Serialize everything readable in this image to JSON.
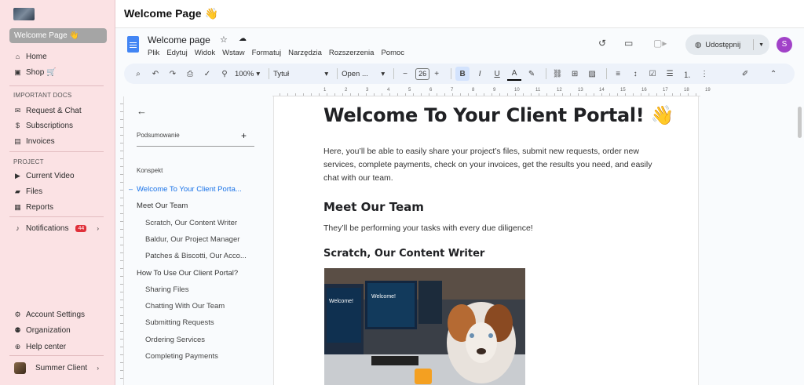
{
  "sidebar": {
    "active_item": "Welcome Page 👋",
    "items": [
      {
        "label": "Home",
        "icon": "home-icon",
        "glyph": "⌂"
      },
      {
        "label": "Shop 🛒",
        "icon": "cart-icon",
        "glyph": "🛒"
      }
    ],
    "important_docs_label": "IMPORTANT DOCS",
    "important_docs": [
      {
        "label": "Request & Chat",
        "icon": "chat-icon",
        "glyph": "✉"
      },
      {
        "label": "Subscriptions",
        "icon": "dollar-icon",
        "glyph": "$"
      },
      {
        "label": "Invoices",
        "icon": "file-icon",
        "glyph": "▤"
      }
    ],
    "project_label": "PROJECT",
    "project": [
      {
        "label": "Current Video",
        "icon": "video-icon",
        "glyph": "▶"
      },
      {
        "label": "Files",
        "icon": "folder-icon",
        "glyph": "▰"
      },
      {
        "label": "Reports",
        "icon": "report-icon",
        "glyph": "▦"
      }
    ],
    "notifications": {
      "label": "Notifications",
      "badge": "44"
    },
    "bottom": [
      {
        "label": "Account Settings",
        "icon": "gear-icon",
        "glyph": "⚙"
      },
      {
        "label": "Organization",
        "icon": "people-icon",
        "glyph": "⚉"
      },
      {
        "label": "Help center",
        "icon": "help-icon",
        "glyph": "⊕"
      }
    ],
    "user": "Summer Client"
  },
  "header": {
    "title": "Welcome Page 👋"
  },
  "docs": {
    "title": "Welcome page",
    "menu": [
      "Plik",
      "Edytuj",
      "Widok",
      "Wstaw",
      "Formatuj",
      "Narzędzia",
      "Rozszerzenia",
      "Pomoc"
    ],
    "share_label": "Udostępnij",
    "user_initial": "S",
    "user_color": "#a142c8",
    "toolbar": {
      "zoom": "100%",
      "style": "Tytuł",
      "font": "Open ...",
      "font_size": "26"
    },
    "ruler_numbers": [
      "1",
      "2",
      "3",
      "4",
      "5",
      "6",
      "7",
      "8",
      "9",
      "10",
      "11",
      "12",
      "13",
      "14",
      "15",
      "16",
      "17",
      "18",
      "19"
    ],
    "outline": {
      "summary_label": "Podsumowanie",
      "outline_label": "Konspekt",
      "items": [
        {
          "label": "Welcome To Your Client Porta...",
          "level": 1,
          "active": true
        },
        {
          "label": "Meet Our Team",
          "level": 1,
          "active": false
        },
        {
          "label": "Scratch, Our Content Writer",
          "level": 2,
          "active": false
        },
        {
          "label": "Baldur, Our Project Manager",
          "level": 2,
          "active": false
        },
        {
          "label": "Patches & Biscotti, Our Acco...",
          "level": 2,
          "active": false
        },
        {
          "label": "How To Use Our Client Portal?",
          "level": 1,
          "active": false
        },
        {
          "label": "Sharing Files",
          "level": 2,
          "active": false
        },
        {
          "label": "Chatting With Our Team",
          "level": 2,
          "active": false
        },
        {
          "label": "Submitting Requests",
          "level": 2,
          "active": false
        },
        {
          "label": "Ordering Services",
          "level": 2,
          "active": false
        },
        {
          "label": "Completing Payments",
          "level": 2,
          "active": false
        }
      ]
    },
    "content": {
      "h1": "Welcome To Your Client Portal! 👋",
      "intro": "Here, you’ll be able to easily share your project’s files, submit new requests, order new services, complete payments, check on your invoices, get the results you need, and easily chat with our team.",
      "h2": "Meet Our Team",
      "team_p": "They’ll be performing your tasks with every due diligence!",
      "h3": "Scratch, Our Content Writer",
      "monitor_text": "Welcome!"
    }
  }
}
